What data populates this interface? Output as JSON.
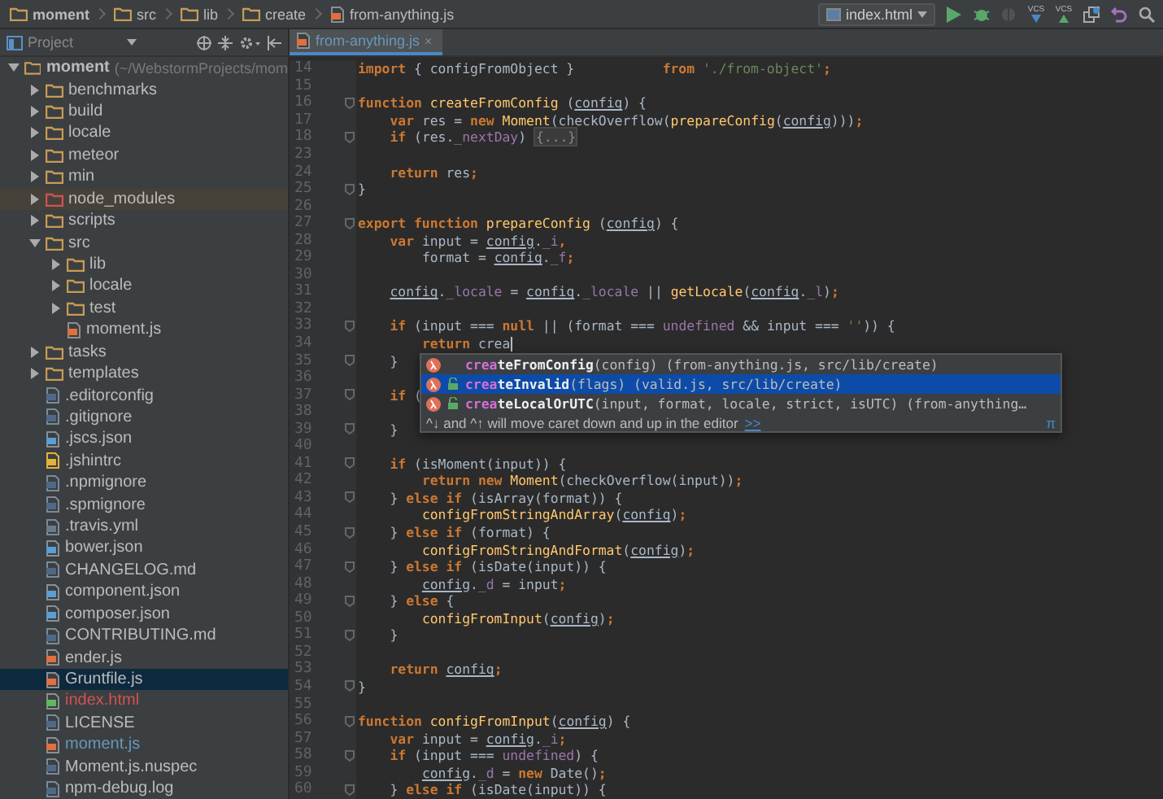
{
  "breadcrumbs": [
    {
      "kind": "folder",
      "label": "moment"
    },
    {
      "kind": "folder",
      "label": "src"
    },
    {
      "kind": "folder",
      "label": "lib"
    },
    {
      "kind": "folder",
      "label": "create"
    },
    {
      "kind": "file",
      "label": "from-anything.js"
    }
  ],
  "toolbar": {
    "run_config": "index.html",
    "buttons": [
      {
        "kind": "run",
        "disabled": false
      },
      {
        "kind": "debug",
        "disabled": false
      },
      {
        "kind": "coverage",
        "disabled": true
      },
      {
        "kind": "vcs-update",
        "label": "VCS",
        "disabled": false
      },
      {
        "kind": "vcs-commit",
        "label": "VCS",
        "disabled": false
      },
      {
        "kind": "history",
        "disabled": false
      },
      {
        "kind": "revert",
        "disabled": false
      },
      {
        "kind": "search",
        "disabled": false
      }
    ]
  },
  "project_panel": {
    "title": "Project"
  },
  "tabs": [
    {
      "label": "from-anything.js",
      "close": "×",
      "selected": true
    }
  ],
  "tree": [
    {
      "kind": "folder",
      "label": "moment",
      "path": "(~/WebstormProjects/mom",
      "expanded": true,
      "selected": false,
      "children": [
        {
          "kind": "folder",
          "label": "benchmarks",
          "expanded": false,
          "selected": false
        },
        {
          "kind": "folder",
          "label": "build",
          "expanded": false,
          "selected": false
        },
        {
          "kind": "folder",
          "label": "locale",
          "expanded": false,
          "selected": false
        },
        {
          "kind": "folder",
          "label": "meteor",
          "expanded": false,
          "selected": false
        },
        {
          "kind": "folder",
          "label": "min",
          "expanded": false,
          "selected": false
        },
        {
          "kind": "excluded",
          "label": "node_modules",
          "expanded": false,
          "selected": false
        },
        {
          "kind": "folder",
          "label": "scripts",
          "expanded": false,
          "selected": false
        },
        {
          "kind": "folder",
          "label": "src",
          "expanded": true,
          "selected": false,
          "children": [
            {
              "kind": "folder",
              "label": "lib",
              "expanded": false,
              "selected": false
            },
            {
              "kind": "folder",
              "label": "locale",
              "expanded": false,
              "selected": false
            },
            {
              "kind": "folder",
              "label": "test",
              "expanded": false,
              "selected": false
            },
            {
              "kind": "js",
              "label": "moment.js",
              "selected": false
            }
          ]
        },
        {
          "kind": "folder",
          "label": "tasks",
          "expanded": false,
          "selected": false
        },
        {
          "kind": "folder",
          "label": "templates",
          "expanded": false,
          "selected": false
        },
        {
          "kind": "text",
          "label": ".editorconfig",
          "selected": false
        },
        {
          "kind": "text",
          "label": ".gitignore",
          "selected": false
        },
        {
          "kind": "json",
          "label": ".jscs.json",
          "selected": false
        },
        {
          "kind": "jshint",
          "label": ".jshintrc",
          "selected": false
        },
        {
          "kind": "text",
          "label": ".npmignore",
          "selected": false
        },
        {
          "kind": "text",
          "label": ".spmignore",
          "selected": false
        },
        {
          "kind": "yml",
          "label": ".travis.yml",
          "selected": false
        },
        {
          "kind": "json",
          "label": "bower.json",
          "selected": false
        },
        {
          "kind": "text",
          "label": "CHANGELOG.md",
          "selected": false
        },
        {
          "kind": "json",
          "label": "component.json",
          "selected": false
        },
        {
          "kind": "json",
          "label": "composer.json",
          "selected": false
        },
        {
          "kind": "text",
          "label": "CONTRIBUTING.md",
          "selected": false
        },
        {
          "kind": "js",
          "label": "ender.js",
          "selected": false
        },
        {
          "kind": "js",
          "label": "Gruntfile.js",
          "selected": true
        },
        {
          "kind": "html",
          "label": "index.html",
          "selected": false,
          "color": "#d25252"
        },
        {
          "kind": "text",
          "label": "LICENSE",
          "selected": false
        },
        {
          "kind": "js",
          "label": "moment.js",
          "selected": false,
          "color": "#6897bb"
        },
        {
          "kind": "text",
          "label": "Moment.js.nuspec",
          "selected": false
        },
        {
          "kind": "text",
          "label": "npm-debug.log",
          "selected": false
        }
      ]
    }
  ],
  "code": [
    {
      "n": "14",
      "tokens": [
        {
          "kind": "k",
          "text": "import"
        },
        {
          "kind": "p",
          "text": " { configFromObject }           "
        },
        {
          "kind": "k",
          "text": "from"
        },
        {
          "kind": "s",
          "text": " './from-object'"
        },
        {
          "kind": "k",
          "text": ";"
        }
      ]
    },
    {
      "n": "15"
    },
    {
      "n": "16",
      "fold": true,
      "tokens": [
        {
          "kind": "k",
          "text": "function"
        },
        {
          "kind": "f",
          "text": " createFromConfig"
        },
        {
          "kind": "p",
          "text": " ("
        },
        {
          "kind": "u",
          "text": "config"
        },
        {
          "kind": "p",
          "text": ") {"
        }
      ]
    },
    {
      "n": "17",
      "tokens": [
        {
          "kind": "k",
          "text": "    var"
        },
        {
          "kind": "p",
          "text": " res = "
        },
        {
          "kind": "k",
          "text": "new"
        },
        {
          "kind": "f",
          "text": " Moment"
        },
        {
          "kind": "p",
          "text": "(checkOverflow("
        },
        {
          "kind": "f",
          "text": "prepareConfig"
        },
        {
          "kind": "p",
          "text": "("
        },
        {
          "kind": "u",
          "text": "config"
        },
        {
          "kind": "p",
          "text": ")))"
        },
        {
          "kind": "k",
          "text": ";"
        }
      ]
    },
    {
      "n": "18",
      "fold": true,
      "tokens": [
        {
          "kind": "k",
          "text": "    if"
        },
        {
          "kind": "p",
          "text": " (res."
        },
        {
          "kind": "v",
          "text": "_nextDay"
        },
        {
          "kind": "p",
          "text": ") "
        },
        {
          "kind": "x",
          "text": "{...}"
        }
      ]
    },
    {
      "n": "23"
    },
    {
      "n": "24",
      "tokens": [
        {
          "kind": "k",
          "text": "    return"
        },
        {
          "kind": "p",
          "text": " res"
        },
        {
          "kind": "k",
          "text": ";"
        }
      ]
    },
    {
      "n": "25",
      "fold": true,
      "tokens": [
        {
          "kind": "p",
          "text": "}"
        }
      ]
    },
    {
      "n": "26"
    },
    {
      "n": "27",
      "fold": true,
      "tokens": [
        {
          "kind": "k",
          "text": "export function"
        },
        {
          "kind": "f",
          "text": " prepareConfig"
        },
        {
          "kind": "p",
          "text": " ("
        },
        {
          "kind": "u",
          "text": "config"
        },
        {
          "kind": "p",
          "text": ") {"
        }
      ]
    },
    {
      "n": "28",
      "tokens": [
        {
          "kind": "k",
          "text": "    var"
        },
        {
          "kind": "p",
          "text": " input = "
        },
        {
          "kind": "u",
          "text": "config"
        },
        {
          "kind": "p",
          "text": "."
        },
        {
          "kind": "v",
          "text": "_i"
        },
        {
          "kind": "k",
          "text": ","
        }
      ]
    },
    {
      "n": "29",
      "tokens": [
        {
          "kind": "p",
          "text": "        format = "
        },
        {
          "kind": "u",
          "text": "config"
        },
        {
          "kind": "p",
          "text": "."
        },
        {
          "kind": "v",
          "text": "_f"
        },
        {
          "kind": "k",
          "text": ";"
        }
      ]
    },
    {
      "n": "30"
    },
    {
      "n": "31",
      "tokens": [
        {
          "kind": "u",
          "text": "    config"
        },
        {
          "kind": "p",
          "text": "."
        },
        {
          "kind": "v",
          "text": "_locale"
        },
        {
          "kind": "p",
          "text": " = "
        },
        {
          "kind": "u",
          "text": "config"
        },
        {
          "kind": "p",
          "text": "."
        },
        {
          "kind": "v",
          "text": "_locale"
        },
        {
          "kind": "p",
          "text": " || "
        },
        {
          "kind": "f",
          "text": "getLocale"
        },
        {
          "kind": "p",
          "text": "("
        },
        {
          "kind": "u",
          "text": "config"
        },
        {
          "kind": "p",
          "text": "."
        },
        {
          "kind": "v",
          "text": "_l"
        },
        {
          "kind": "p",
          "text": ")"
        },
        {
          "kind": "k",
          "text": ";"
        }
      ]
    },
    {
      "n": "32"
    },
    {
      "n": "33",
      "fold": true,
      "tokens": [
        {
          "kind": "k",
          "text": "    if"
        },
        {
          "kind": "p",
          "text": " (input === "
        },
        {
          "kind": "k",
          "text": "null"
        },
        {
          "kind": "p",
          "text": " || (format === "
        },
        {
          "kind": "v",
          "text": "undefined"
        },
        {
          "kind": "p",
          "text": " && input === "
        },
        {
          "kind": "s",
          "text": "''"
        },
        {
          "kind": "p",
          "text": ")) {"
        }
      ]
    },
    {
      "n": "34",
      "caret": true,
      "tokens": [
        {
          "kind": "k",
          "text": "        return"
        },
        {
          "kind": "p",
          "text": " crea"
        }
      ]
    },
    {
      "n": "35",
      "fold": true,
      "tokens": [
        {
          "kind": "p",
          "text": "    }"
        }
      ]
    },
    {
      "n": "36"
    },
    {
      "n": "37",
      "fold": true,
      "tokens": [
        {
          "kind": "k",
          "text": "    if"
        },
        {
          "kind": "p",
          "text": " ("
        }
      ]
    },
    {
      "n": "38"
    },
    {
      "n": "39",
      "fold": true,
      "tokens": [
        {
          "kind": "p",
          "text": "    }"
        }
      ]
    },
    {
      "n": "40"
    },
    {
      "n": "41",
      "fold": true,
      "tokens": [
        {
          "kind": "k",
          "text": "    if"
        },
        {
          "kind": "p",
          "text": " (isMoment(input)) {"
        }
      ]
    },
    {
      "n": "42",
      "tokens": [
        {
          "kind": "k",
          "text": "        return new"
        },
        {
          "kind": "f",
          "text": " Moment"
        },
        {
          "kind": "p",
          "text": "(checkOverflow(input))"
        },
        {
          "kind": "k",
          "text": ";"
        }
      ]
    },
    {
      "n": "43",
      "fold": true,
      "tokens": [
        {
          "kind": "p",
          "text": "    } "
        },
        {
          "kind": "k",
          "text": "else if"
        },
        {
          "kind": "p",
          "text": " (isArray(format)) {"
        }
      ]
    },
    {
      "n": "44",
      "tokens": [
        {
          "kind": "f",
          "text": "        configFromStringAndArray"
        },
        {
          "kind": "p",
          "text": "("
        },
        {
          "kind": "u",
          "text": "config"
        },
        {
          "kind": "p",
          "text": ")"
        },
        {
          "kind": "k",
          "text": ";"
        }
      ]
    },
    {
      "n": "45",
      "fold": true,
      "tokens": [
        {
          "kind": "p",
          "text": "    } "
        },
        {
          "kind": "k",
          "text": "else if"
        },
        {
          "kind": "p",
          "text": " (format) {"
        }
      ]
    },
    {
      "n": "46",
      "tokens": [
        {
          "kind": "f",
          "text": "        configFromStringAndFormat"
        },
        {
          "kind": "p",
          "text": "("
        },
        {
          "kind": "u",
          "text": "config"
        },
        {
          "kind": "p",
          "text": ")"
        },
        {
          "kind": "k",
          "text": ";"
        }
      ]
    },
    {
      "n": "47",
      "fold": true,
      "tokens": [
        {
          "kind": "p",
          "text": "    } "
        },
        {
          "kind": "k",
          "text": "else if"
        },
        {
          "kind": "p",
          "text": " (isDate(input)) {"
        }
      ]
    },
    {
      "n": "48",
      "tokens": [
        {
          "kind": "u",
          "text": "        config"
        },
        {
          "kind": "p",
          "text": "."
        },
        {
          "kind": "v",
          "text": "_d"
        },
        {
          "kind": "p",
          "text": " = input"
        },
        {
          "kind": "k",
          "text": ";"
        }
      ]
    },
    {
      "n": "49",
      "fold": true,
      "tokens": [
        {
          "kind": "p",
          "text": "    } "
        },
        {
          "kind": "k",
          "text": "else"
        },
        {
          "kind": "p",
          "text": " {"
        }
      ]
    },
    {
      "n": "50",
      "tokens": [
        {
          "kind": "f",
          "text": "        configFromInput"
        },
        {
          "kind": "p",
          "text": "("
        },
        {
          "kind": "u",
          "text": "config"
        },
        {
          "kind": "p",
          "text": ")"
        },
        {
          "kind": "k",
          "text": ";"
        }
      ]
    },
    {
      "n": "51",
      "fold": true,
      "tokens": [
        {
          "kind": "p",
          "text": "    }"
        }
      ]
    },
    {
      "n": "52"
    },
    {
      "n": "53",
      "tokens": [
        {
          "kind": "k",
          "text": "    return "
        },
        {
          "kind": "u",
          "text": "config"
        },
        {
          "kind": "k",
          "text": ";"
        }
      ]
    },
    {
      "n": "54",
      "fold": true,
      "tokens": [
        {
          "kind": "p",
          "text": "}"
        }
      ]
    },
    {
      "n": "55"
    },
    {
      "n": "56",
      "fold": true,
      "tokens": [
        {
          "kind": "k",
          "text": "function"
        },
        {
          "kind": "f",
          "text": " configFromInput"
        },
        {
          "kind": "p",
          "text": "("
        },
        {
          "kind": "u",
          "text": "config"
        },
        {
          "kind": "p",
          "text": ") {"
        }
      ]
    },
    {
      "n": "57",
      "tokens": [
        {
          "kind": "k",
          "text": "    var"
        },
        {
          "kind": "p",
          "text": " input = "
        },
        {
          "kind": "u",
          "text": "config"
        },
        {
          "kind": "p",
          "text": "."
        },
        {
          "kind": "v",
          "text": "_i"
        },
        {
          "kind": "k",
          "text": ";"
        }
      ]
    },
    {
      "n": "58",
      "fold": true,
      "tokens": [
        {
          "kind": "k",
          "text": "    if"
        },
        {
          "kind": "p",
          "text": " (input === "
        },
        {
          "kind": "v",
          "text": "undefined"
        },
        {
          "kind": "p",
          "text": ") {"
        }
      ]
    },
    {
      "n": "59",
      "tokens": [
        {
          "kind": "u",
          "text": "        config"
        },
        {
          "kind": "p",
          "text": "."
        },
        {
          "kind": "v",
          "text": "_d"
        },
        {
          "kind": "p",
          "text": " = "
        },
        {
          "kind": "k",
          "text": "new"
        },
        {
          "kind": "p",
          "text": " Date()"
        },
        {
          "kind": "k",
          "text": ";"
        }
      ]
    },
    {
      "n": "60",
      "fold": true,
      "tokens": [
        {
          "kind": "p",
          "text": "    } "
        },
        {
          "kind": "k",
          "text": "else if"
        },
        {
          "kind": "p",
          "text": " (isDate(input)) {"
        }
      ]
    }
  ],
  "completion": {
    "items": [
      {
        "match": "crea",
        "rest": "teFromConfig",
        "tail": "(config) (from-anything.js, src/lib/create)",
        "locked": false,
        "selected": false
      },
      {
        "match": "crea",
        "rest": "teInvalid",
        "tail": "(flags) (valid.js, src/lib/create)",
        "locked": true,
        "selected": true
      },
      {
        "match": "crea",
        "rest": "teLocalOrUTC",
        "tail": "(input, format, locale, strict, isUTC) (from-anything…",
        "locked": true,
        "selected": false
      }
    ],
    "hint": "^↓ and ^↑ will move caret down and up in the editor",
    "hint_link": ">>",
    "corner": "π"
  }
}
